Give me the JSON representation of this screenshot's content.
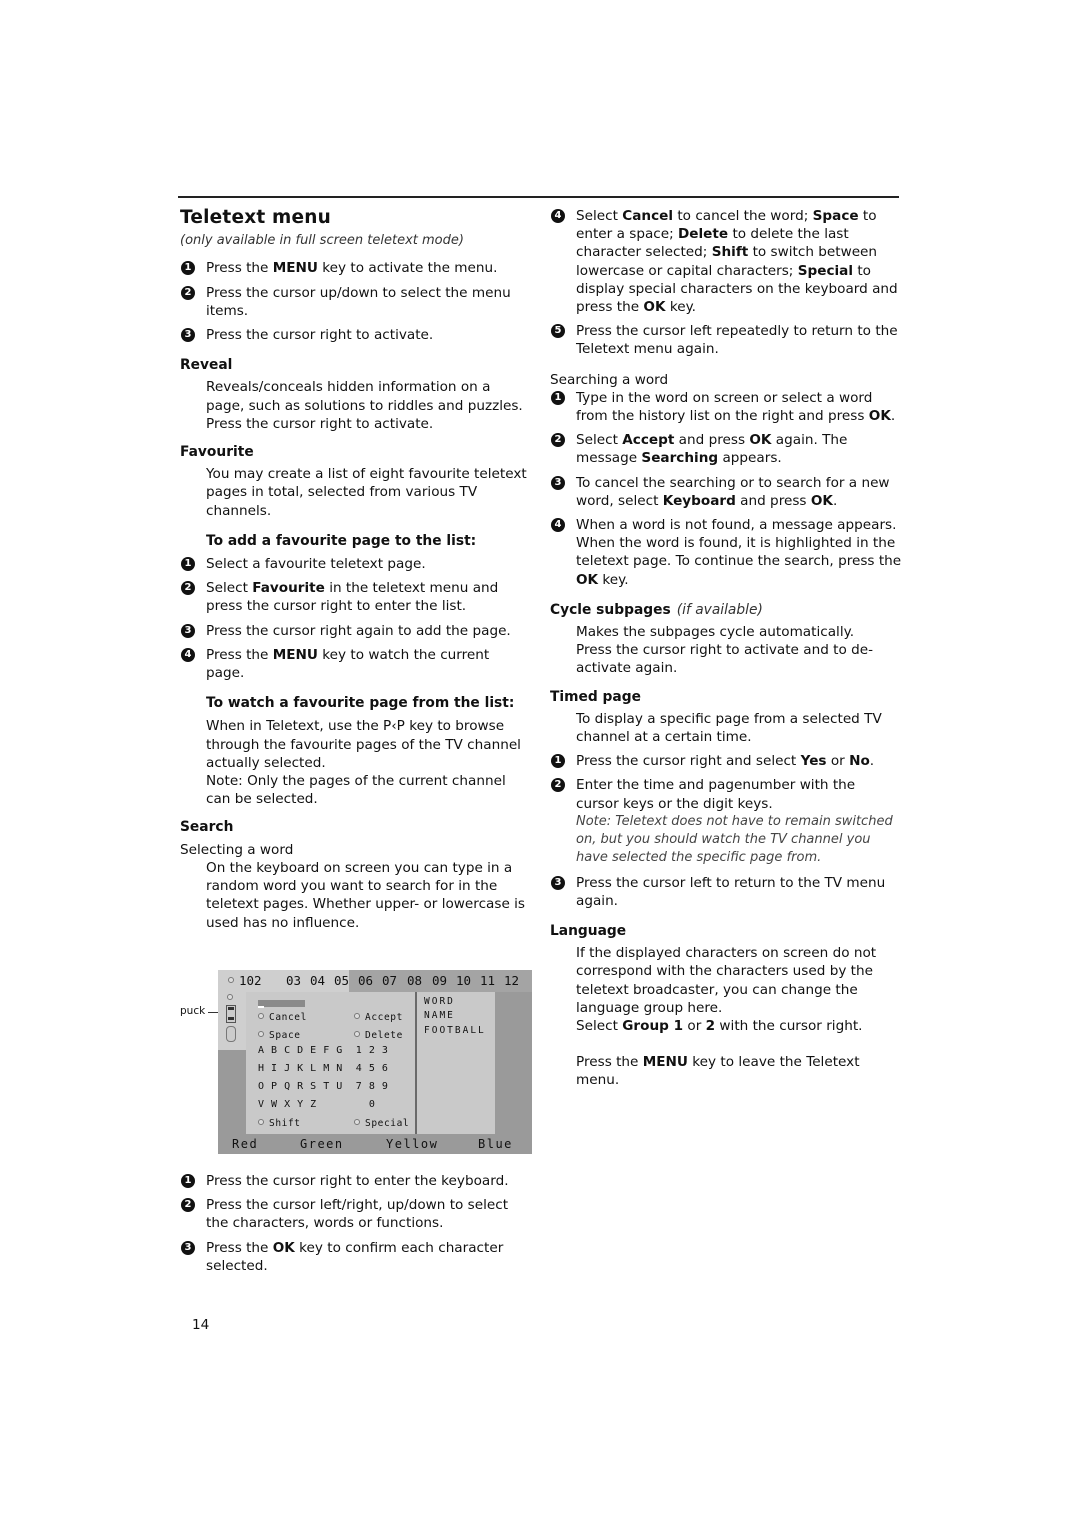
{
  "page": {
    "title": "Teletext menu",
    "subtitle": "(only available in full screen teletext mode)",
    "page_number": "14"
  },
  "intro_steps": [
    {
      "num": "1",
      "pre": "Press the ",
      "bold": "MENU",
      "post": " key to activate the menu."
    },
    {
      "num": "2",
      "text": "Press the cursor up/down to select the menu items."
    },
    {
      "num": "3",
      "text": "Press the cursor right to activate."
    }
  ],
  "reveal": {
    "heading": "Reveal",
    "body": "Reveals/conceals hidden information on a page, such as solutions to riddles and puzzles.",
    "body2": "Press the cursor right to activate."
  },
  "favourite": {
    "heading": "Favourite",
    "body": "You may create a list of eight favourite teletext pages in total, selected from various TV channels.",
    "add_heading": "To add a favourite page to the list:",
    "add_steps": [
      {
        "num": "1",
        "text": "Select a favourite teletext page."
      },
      {
        "num": "2",
        "pre": "Select ",
        "bold": "Favourite",
        "post": " in the teletext menu and press the cursor right to enter the list."
      },
      {
        "num": "3",
        "text": "Press the cursor right again to add the page."
      },
      {
        "num": "4",
        "pre": "Press the ",
        "bold": "MENU",
        "post": " key to watch the current page."
      }
    ],
    "watch_heading": "To watch a favourite page from the list:",
    "watch_body": "When in Teletext, use the P‹P key to browse through the favourite pages of the TV channel actually selected.",
    "watch_note": "Note: Only the pages of the current channel can be selected."
  },
  "search": {
    "heading": "Search",
    "sub": "Selecting a word",
    "body": "On the keyboard on screen you can type in a random word you want to search for in the teletext pages. Whether upper- or lowercase is used has no influence.",
    "steps": [
      {
        "num": "1",
        "text": "Press the cursor right to enter the keyboard."
      },
      {
        "num": "2",
        "text": "Press the cursor left/right, up/down to select the characters, words or functions."
      },
      {
        "num": "3",
        "pre": "Press the ",
        "bold": "OK",
        "post": " key to confirm each character selected."
      }
    ]
  },
  "teletext_screen": {
    "puck_label": "puck",
    "current_page": "102",
    "pages": [
      "03",
      "04",
      "05",
      "06",
      "07",
      "08",
      "09",
      "10",
      "11",
      "12"
    ],
    "options": {
      "cancel": "Cancel",
      "accept": "Accept",
      "space": "Space",
      "delete": "Delete",
      "shift": "Shift",
      "special": "Special"
    },
    "keyboard_rows": [
      "A B C D E F G  1 2 3",
      "H I J K L M N  4 5 6",
      "O P Q R S T U  7 8 9",
      "V W X Y Z        0"
    ],
    "history": [
      "WORD",
      "NAME",
      "FOOTBALL"
    ],
    "color_keys": [
      "Red",
      "Green",
      "Yellow",
      "Blue"
    ]
  },
  "right": {
    "step4": {
      "num": "4"
    },
    "step5": {
      "num": "5",
      "text": "Press the cursor left repeatedly to return to the Teletext menu again."
    },
    "step4_parts": {
      "t1": "Select ",
      "b1": "Cancel",
      "t2": " to cancel the word; ",
      "b2": "Space",
      "t3": " to enter a space; ",
      "b3": "Delete",
      "t4": " to delete the last character selected; ",
      "b4": "Shift",
      "t5": " to switch between lowercase or capital characters; ",
      "b5": "Special",
      "t6": " to display special characters on the keyboard and press the ",
      "b6": "OK",
      "t7": " key."
    },
    "searching": {
      "sub": "Searching a word",
      "s1": {
        "num": "1",
        "pre": "Type in the word on screen or select a word from the history list on the right and press ",
        "bold": "OK",
        "post": "."
      },
      "s2": {
        "num": "2",
        "t1": "Select ",
        "b1": "Accept",
        "t2": " and press ",
        "b2": "OK",
        "t3": " again. The message ",
        "b3": "Searching",
        "t4": " appears."
      },
      "s3": {
        "num": "3",
        "t1": "To cancel the searching or to search for a new word, select ",
        "b1": "Keyboard",
        "t2": " and press ",
        "b2": "OK",
        "t3": "."
      },
      "s4": {
        "num": "4",
        "pre": "When a word is not found, a message appears. When the word is found, it is highlighted in the teletext page. To continue the search, press the ",
        "bold": "OK",
        "post": " key."
      }
    },
    "cycle": {
      "heading": "Cycle subpages",
      "note": "(if available)",
      "body": "Makes the subpages cycle automatically.",
      "body2": "Press the cursor right to activate and to de-activate again."
    },
    "timed": {
      "heading": "Timed page",
      "body": "To display a specific page from a selected TV channel at a certain time.",
      "s1": {
        "num": "1",
        "t1": "Press the cursor right and select ",
        "b1": "Yes",
        "t2": " or ",
        "b2": "No",
        "t3": "."
      },
      "s2": {
        "num": "2",
        "text": "Enter the time and pagenumber with the cursor keys or the digit keys.",
        "note": "Note: Teletext does not have to remain switched on, but you should watch the TV channel you have selected the specific page from."
      },
      "s3": {
        "num": "3",
        "text": "Press the cursor left to return to the TV menu again."
      }
    },
    "language": {
      "heading": "Language",
      "body": "If the displayed characters on screen do not correspond with the characters used by the teletext broadcaster, you can change the language group here.",
      "select": {
        "t1": "Select ",
        "b1": "Group 1",
        "t2": " or ",
        "b2": "2",
        "t3": " with the cursor right."
      },
      "leave": {
        "t1": "Press the ",
        "b1": "MENU",
        "t2": " key to leave the Teletext menu."
      }
    }
  }
}
